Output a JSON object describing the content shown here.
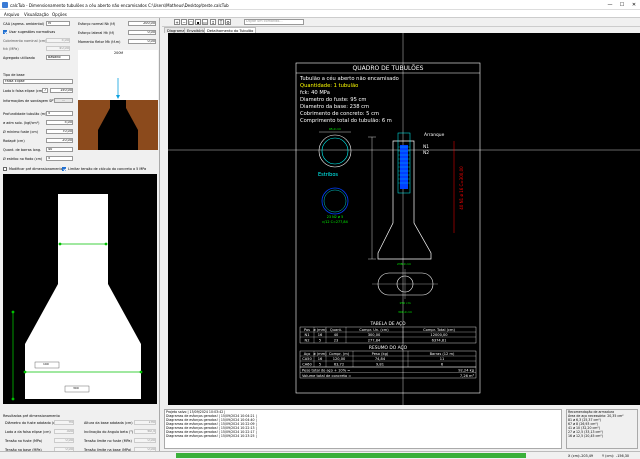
{
  "window": {
    "title": "calcTub - Dimensionamento tubulões a céu aberto não encamisados C:\\Users\\Matheus\\Desktop\\teste.calcTub",
    "min": "—",
    "max": "☐",
    "close": "✕"
  },
  "menu": [
    "Arquivo",
    "Visualização",
    "Opções"
  ],
  "left": {
    "caa_label": "CAA (agress. ambiental)",
    "caa_value": "IV",
    "use_suggested": "Usar sugestões normativas",
    "cobrimento_label": "Cobrimento nominal (cm)",
    "cobrimento_value": "5,00",
    "fck_label": "fck (MPa)",
    "fck_value": "40,00",
    "agregado_label": "Agregado utilizado",
    "agregado_value": "Basalto",
    "esforco_normal_label": "Esforço normal Nk (tf)",
    "esforco_normal_value": "200,00",
    "esforco_lateral_label": "Esforço lateral Hk (tf)",
    "esforco_lateral_value": "0,00",
    "momento_label": "Momento fletor Mk (tf.m)",
    "momento_value": "0,00",
    "preview_load": "200tf",
    "tipo_base_label": "Tipo de base",
    "tipo_base_value": "Falsa Elipse",
    "lado_label": "Lado b falsa elipse (cm)",
    "lado_n": "7",
    "lado_value": "150,00",
    "sondagem_label": "Informações de sondagem SPT",
    "prof_label": "Profundidade tubulão (m)",
    "prof_value": "5",
    "adm_label": "σ adm solo. (kgf/cm²)",
    "adm_value": "5,00",
    "fuste_label": "Ø mínimo fuste (cm)",
    "fuste_value": "70,00",
    "rodape_label": "Rodapé (cm)",
    "rodape_value": "20,00",
    "barras_label": "Quant. de barras long.",
    "barras_value": "40",
    "estribo_label": "Ø estribo no fiado (cm)",
    "estribo_value": "5",
    "modificar": "Modificar pré dimensionamento",
    "limitar": "Limitar tensão de cálculo do concreto a 5 MPa",
    "dim_label_1": "190",
    "dim_label_2": "300",
    "results_title": "Resultados pré dimensionamento",
    "results": [
      {
        "label": "Diâmetro do fuste adotado (cm)",
        "value": "95"
      },
      {
        "label": "Altura da base adotada (cm)",
        "value": "190"
      },
      {
        "label": "Lado a da falsa elipse (cm)",
        "value": "300"
      },
      {
        "label": "Inclinação do ângulo beta (°)",
        "value": "60,5"
      },
      {
        "label": "Tensão no fuste (MPa)",
        "value": "0,00"
      },
      {
        "label": "Tensão limite no fuste (MPa)",
        "value": "0,00"
      },
      {
        "label": "Tensão na base (MPa)",
        "value": "0,00"
      },
      {
        "label": "Tensão limite na base (MPa)",
        "value": "0,00"
      }
    ]
  },
  "toolbar": {
    "command_placeholder": "Digite um comando..."
  },
  "tabs": [
    "Diagramas",
    "Envoltória",
    "Detalhamento do Tubulão"
  ],
  "drawing": {
    "quadro_title": "QUADRO DE TUBULÕES",
    "info": [
      "Tubulão a céu aberto não encamisado",
      "Quantidade: 1 tubulão",
      "fck: 40 MPa",
      "Diametro do fuste: 95 cm",
      "Diametro da base: 238 cm",
      "Cobrimento de concreto: 5 cm",
      "Comprimento total do tubulão: 6 m"
    ],
    "arranque": "Arranque",
    "n1": "N1",
    "n2": "N2",
    "estribos": "Estribos",
    "estribo_spec": "23 N2 ø 5",
    "estribo_spec2": "c/12 C=277,84",
    "n1_spec": "40 N1 ø 16 C=300,00",
    "dim_95": "95,0 cm",
    "dim_238": "238,0 cm",
    "dim_300": "300,0 cm",
    "dim_150": "150 cm",
    "table_aco_title": "TABELA DE AÇO",
    "table_aco_headers": [
      "Pos",
      "ø (mm)",
      "Quant.",
      "Compr. Un. (cm)",
      "Compr. Total (cm)"
    ],
    "table_aco_rows": [
      [
        "N1",
        "16",
        "40",
        "300,00",
        "12000,00"
      ],
      [
        "N2",
        "5",
        "23",
        "277,84",
        "6374,81"
      ]
    ],
    "resumo_title": "RESUMO DO AÇO",
    "resumo_headers": [
      "Aço",
      "ø (mm)",
      "Compr. (m)",
      "Peso (kg)",
      "Barras (12 m)"
    ],
    "resumo_rows": [
      [
        "CA50",
        "16",
        "120,00",
        "74,84",
        "11"
      ],
      [
        "CA60",
        "5",
        "63,72",
        "9,81",
        "6"
      ]
    ],
    "peso_label": "Peso total do aço + 10% =",
    "peso_value": "92,24 kg",
    "volume_label": "Volume total de concreto =",
    "volume_value": "7,26 m³"
  },
  "log": [
    "Projeto salvo | 15/09/2024 10:03:42 |",
    "Diagramas de esforços gerados! | 15/09/2024 10:04:21 |",
    "Diagramas de esforços gerados! | 15/09/2024 10:04:40 |",
    "Diagramas de esforços gerados! | 15/09/2024 10:22:09 |",
    "Diagramas de esforços gerados! | 15/09/2024 10:22:13 |",
    "Diagramas de esforços gerados! | 15/09/2024 10:22:17 |",
    "Diagramas de esforços gerados! | 15/09/2024 10:23:25 |"
  ],
  "recom": {
    "title": "Recomendação de armadura",
    "lines": [
      "Área de aço necessária: 20,35 cm²",
      "",
      "81 ø 6,3 (25,37 cm²)",
      "67 ø 8 (26,93 cm²)",
      "41 ø 10 (32,20 cm²)",
      "27 ø 12,5 (33,13 cm²)",
      "16 ø 12,5 (20,45 cm²)"
    ]
  },
  "status": {
    "x_label": "X (cm):",
    "x_value": "-203,49",
    "y_label": "Y (cm):",
    "y_value": "-156,30"
  },
  "colors": {
    "cyan": "#00ffff",
    "green": "#00ff00",
    "yellow": "#ffff00",
    "blue": "#0040ff",
    "white": "#ffffff",
    "orange": "#d08020"
  }
}
